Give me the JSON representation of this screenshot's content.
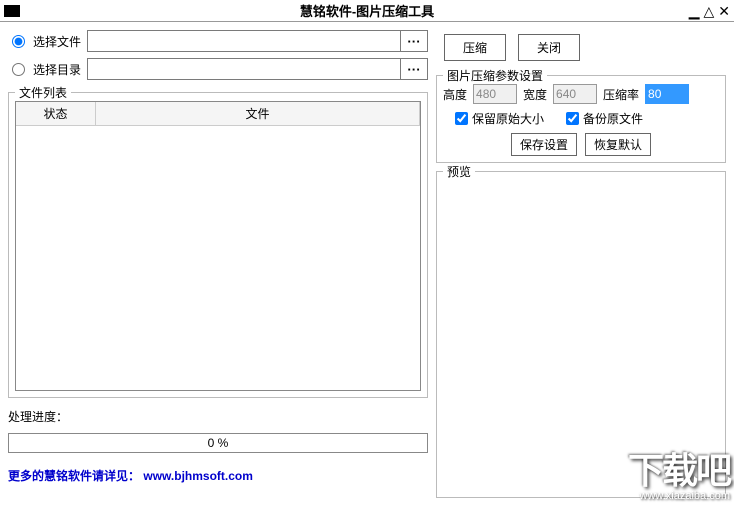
{
  "window": {
    "title": "慧铭软件-图片压缩工具"
  },
  "source": {
    "file_radio": "选择文件",
    "dir_radio": "选择目录",
    "file_path": "",
    "dir_path": "",
    "browse": "···"
  },
  "file_list": {
    "legend": "文件列表",
    "col_status": "状态",
    "col_file": "文件"
  },
  "progress": {
    "label": "处理进度：",
    "text": "0 %"
  },
  "footer": {
    "prefix": "更多的慧铭软件请详见：",
    "url": "www.bjhmsoft.com"
  },
  "actions": {
    "compress": "压缩",
    "close": "关闭"
  },
  "params": {
    "legend": "图片压缩参数设置",
    "height_label": "高度",
    "height_value": "480",
    "width_label": "宽度",
    "width_value": "640",
    "ratio_label": "压缩率",
    "ratio_value": "80",
    "keep_size": "保留原始大小",
    "backup": "备份原文件",
    "save": "保存设置",
    "restore": "恢复默认"
  },
  "preview": {
    "legend": "预览"
  },
  "watermark": {
    "big": "下载吧",
    "small": "www.xiazaiba.com"
  }
}
